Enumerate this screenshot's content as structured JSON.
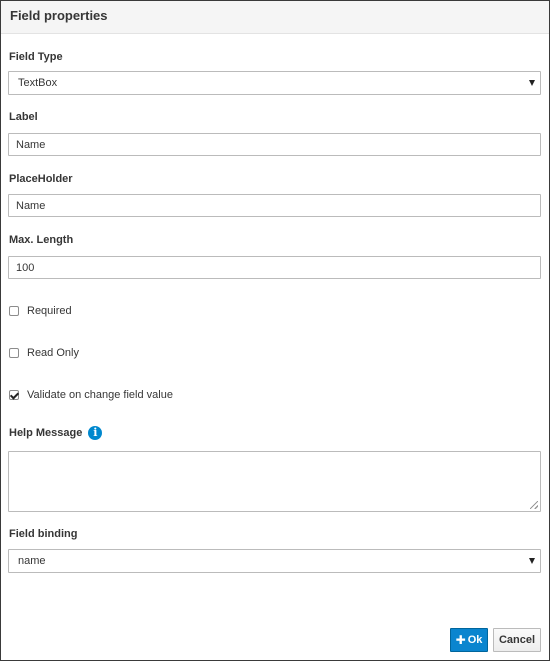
{
  "dialog": {
    "title": "Field properties"
  },
  "form": {
    "field_type": {
      "label": "Field Type",
      "value": "TextBox"
    },
    "label_field": {
      "label": "Label",
      "value": "Name"
    },
    "placeholder_field": {
      "label": "PlaceHolder",
      "value": "Name"
    },
    "max_length": {
      "label": "Max. Length",
      "value": "100"
    },
    "required": {
      "label": "Required",
      "checked": false
    },
    "read_only": {
      "label": "Read Only",
      "checked": false
    },
    "validate_on_change": {
      "label": "Validate on change field value",
      "checked": true
    },
    "help_message": {
      "label": "Help Message",
      "value": "",
      "icon": "info-icon"
    },
    "field_binding": {
      "label": "Field binding",
      "value": "name"
    }
  },
  "buttons": {
    "ok_label": "Ok",
    "ok_icon": "plus-icon",
    "cancel_label": "Cancel"
  },
  "colors": {
    "primary": "#0a85cf",
    "info_icon": "#0088ce",
    "header_bg": "#f5f5f5"
  }
}
